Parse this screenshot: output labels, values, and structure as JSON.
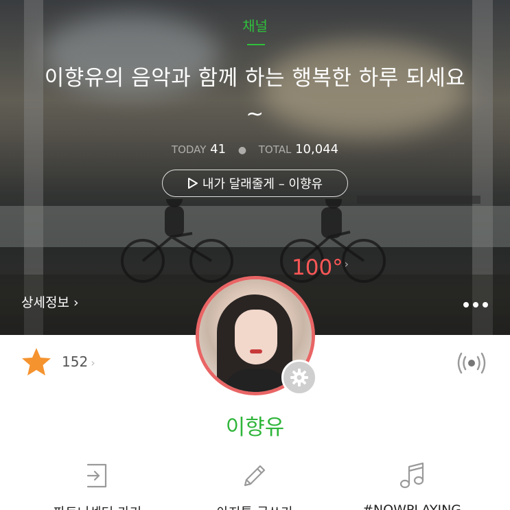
{
  "hero": {
    "channel_label": "채널",
    "title": "이향유의 음악과 함께 하는 행복한 하루 되세요~",
    "stats": {
      "today_label": "TODAY",
      "today_value": "41",
      "total_label": "TOTAL",
      "total_value": "10,044"
    },
    "now_song": "내가 달래줄게 – 이향유",
    "temperature": "100°",
    "detail_link": "상세정보 ›",
    "more_icon": "more-dots-icon"
  },
  "profile": {
    "name": "이향유",
    "star_count": "152",
    "settings_icon": "gear-icon",
    "broadcast_icon": "broadcast-icon"
  },
  "actions": [
    {
      "label": "파트너센터 가기",
      "icon": "enter-icon"
    },
    {
      "label": "아지톡 글쓰기",
      "icon": "pencil-icon"
    },
    {
      "label": "#NOWPLAYING",
      "icon": "music-note-icon"
    }
  ],
  "colors": {
    "accent_green": "#2fc03c",
    "temperature_red": "#ff5757",
    "avatar_ring": "#e96565",
    "star_orange": "#f5932f"
  }
}
